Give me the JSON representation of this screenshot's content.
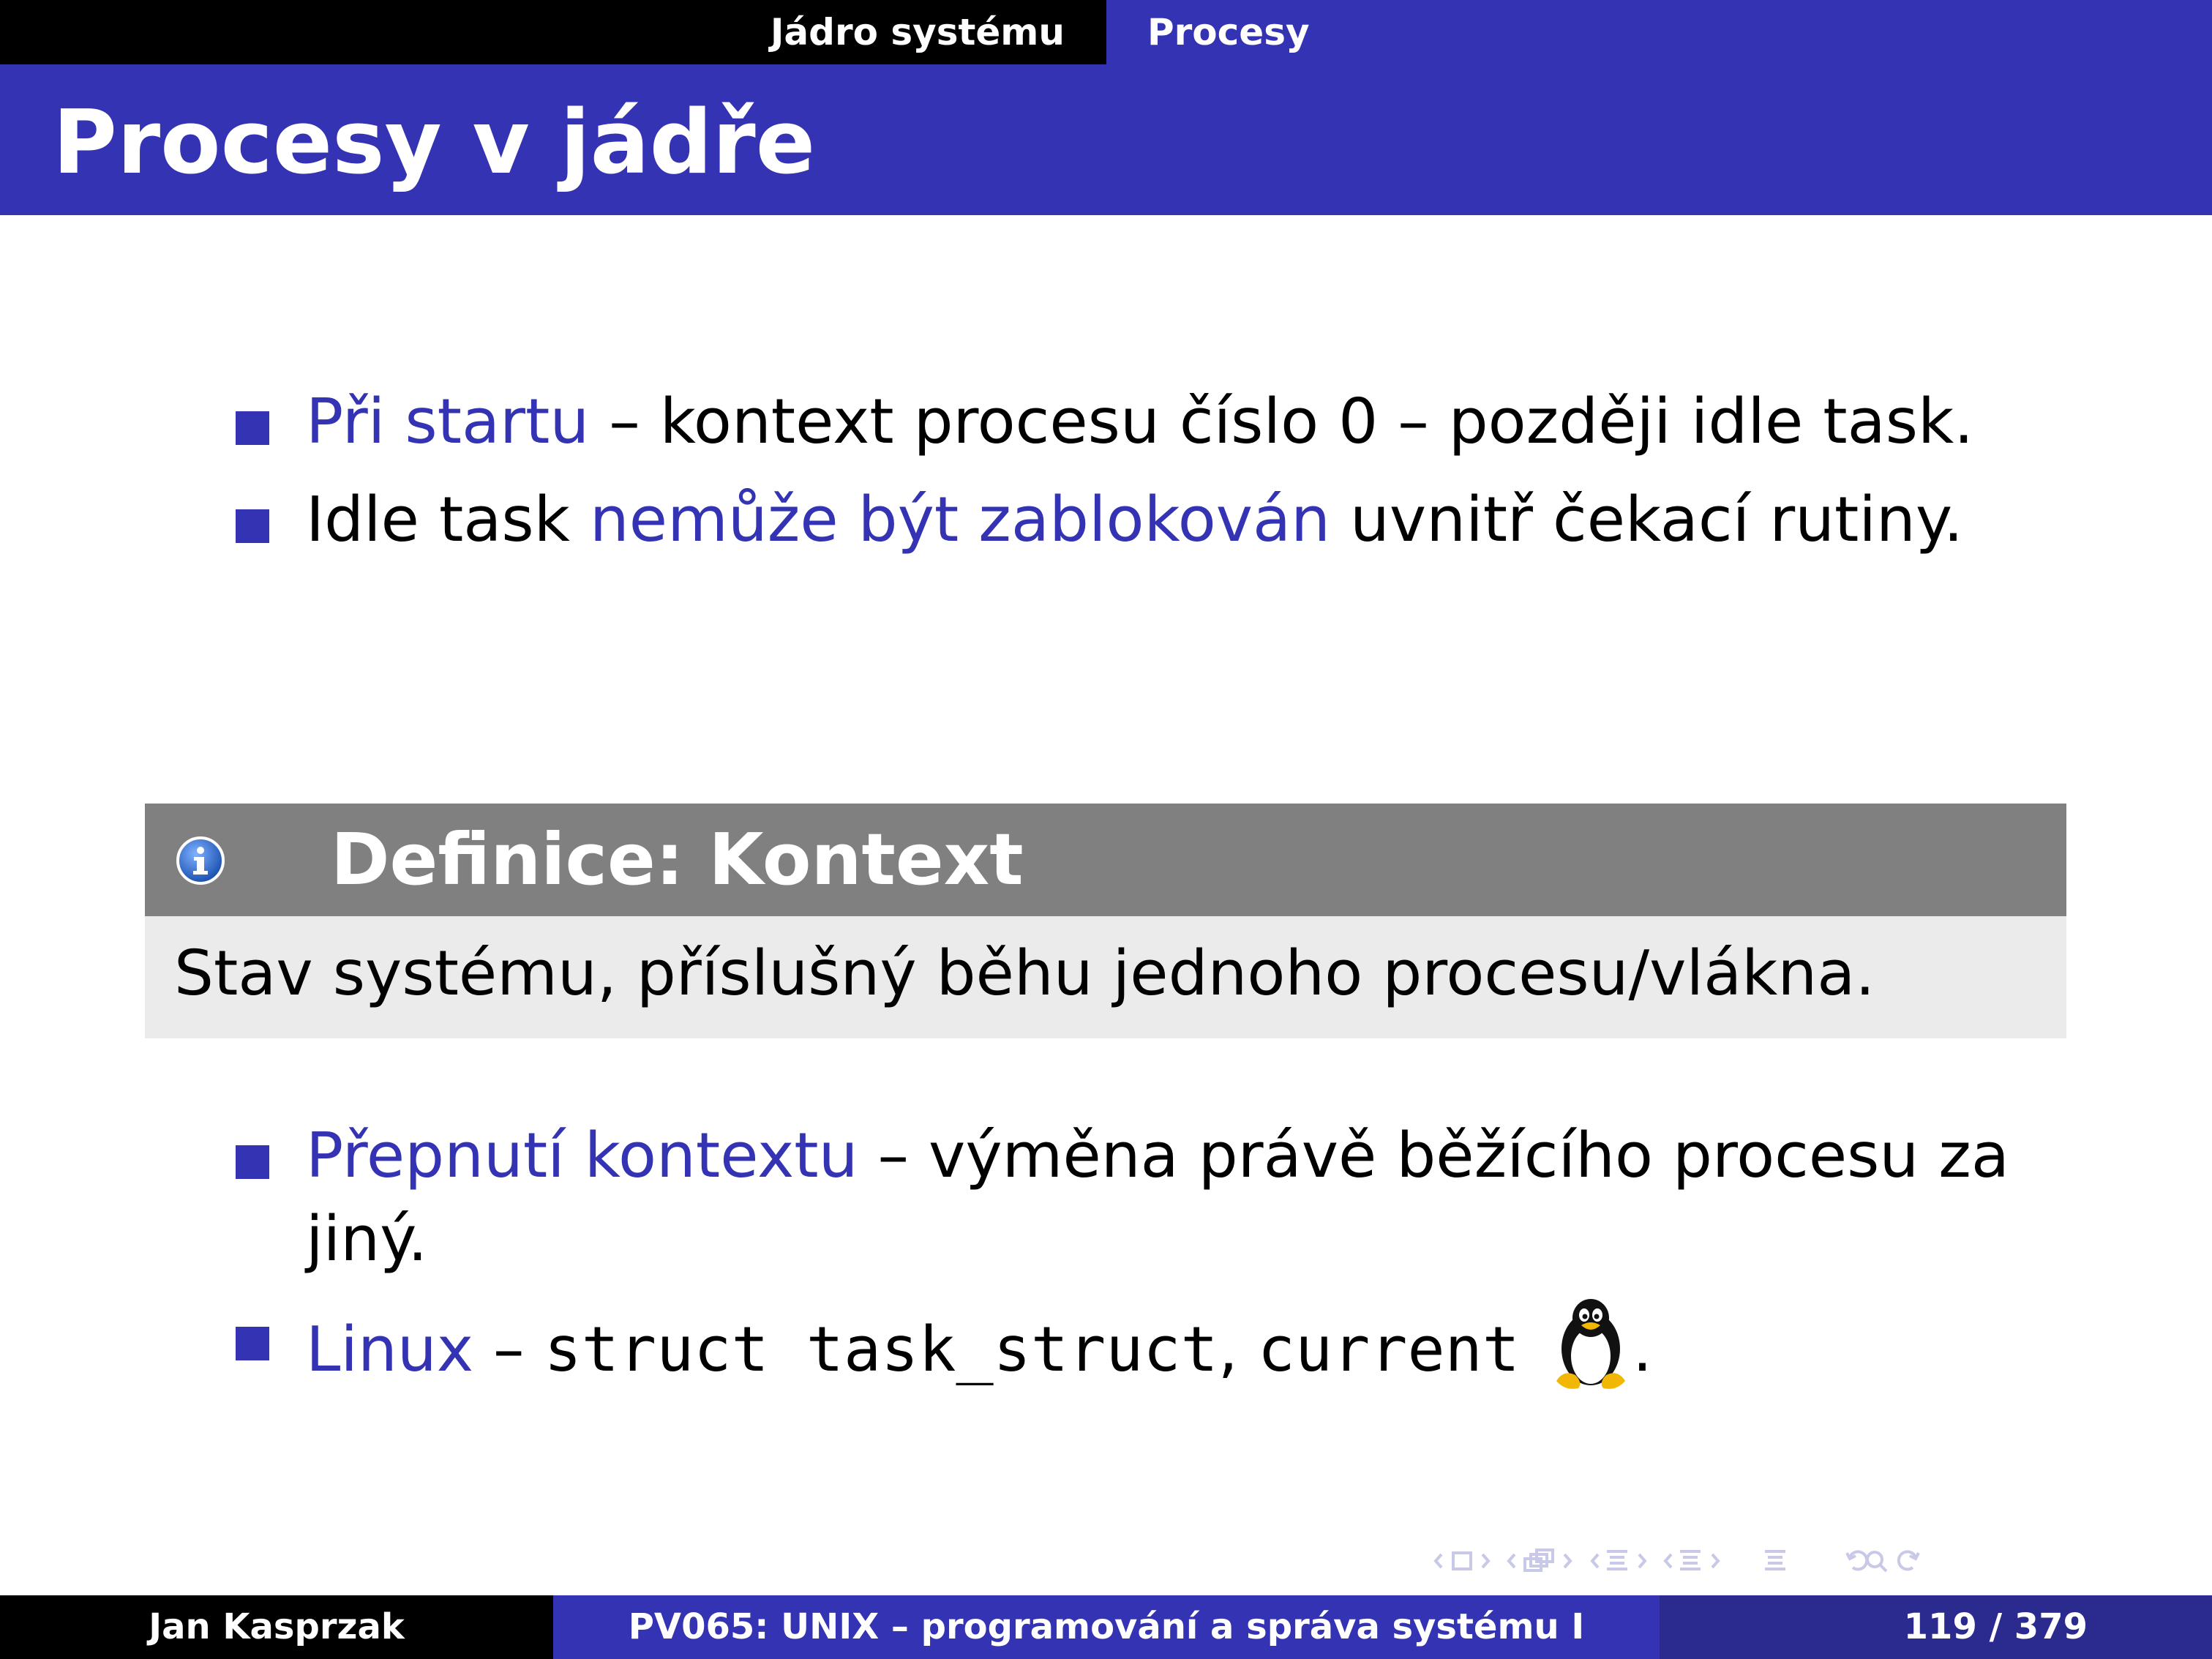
{
  "header": {
    "section": "Jádro systému",
    "subsection": "Procesy"
  },
  "title": "Procesy v jádře",
  "bullets1": [
    {
      "highlight": "Při startu",
      "text": " – kontext procesu číslo 0 – později idle task."
    },
    {
      "pre": "Idle task ",
      "highlight": "nemůže být zablokován",
      "text": " uvnitř čekací rutiny."
    }
  ],
  "definition": {
    "icon": "info-icon",
    "title": "Definice: Kontext",
    "body": "Stav systému, příslušný běhu jednoho procesu/vlákna."
  },
  "bullets2": [
    {
      "highlight": "Přepnutí kontextu",
      "text": " – výměna právě běžícího procesu za jiný."
    },
    {
      "highlight": "Linux",
      "sep": " – ",
      "code1": "struct task_struct",
      "comma": ", ",
      "code2": "current",
      "end": ".",
      "icon": "tux-icon"
    }
  ],
  "footer": {
    "author": "Jan Kasprzak",
    "course": "PV065: UNIX – programování a správa systému I",
    "page": "119 / 379"
  },
  "colors": {
    "accent": "#3333b3",
    "box_header": "#808080",
    "box_body": "#ebebeb"
  }
}
